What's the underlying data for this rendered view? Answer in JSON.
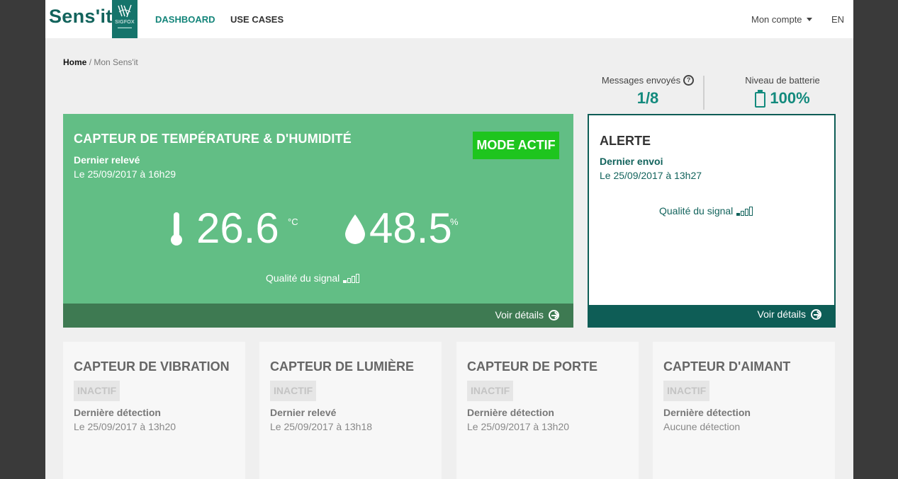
{
  "header": {
    "logo_text": "Sens'it",
    "logo_badge": "SIGFOX",
    "nav": [
      "DASHBOARD",
      "USE CASES"
    ],
    "account_label": "Mon compte",
    "language": "EN"
  },
  "breadcrumb": {
    "home": "Home",
    "separator": "/",
    "current": "Mon Sens'it"
  },
  "stats": {
    "messages_label": "Messages envoyés",
    "messages_value": "1/8",
    "battery_label": "Niveau de batterie",
    "battery_value": "100%",
    "battery_level": 1.0
  },
  "main_card": {
    "title": "CAPTEUR DE TEMPÉRATURE & D'HUMIDITÉ",
    "last_label": "Dernier relevé",
    "last_date": "Le 25/09/2017 à 16h29",
    "mode": "MODE ACTIF",
    "temperature": "26.6",
    "temperature_unit": "°C",
    "humidity": "48.5",
    "humidity_unit": "%",
    "signal_label": "Qualité du signal",
    "signal_level": 1,
    "details": "Voir détails",
    "color": "#62be85"
  },
  "alert_card": {
    "title": "ALERTE",
    "last_label": "Dernier envoi",
    "last_date": "Le 25/09/2017 à 13h27",
    "signal_label": "Qualité du signal",
    "signal_level": 1,
    "details": "Voir détails",
    "color": "#0e5d56"
  },
  "sensors": [
    {
      "title": "CAPTEUR DE VIBRATION",
      "status": "INACTIF",
      "last_label": "Dernière détection",
      "last_value": "Le 25/09/2017 à 13h20"
    },
    {
      "title": "CAPTEUR DE LUMIÈRE",
      "status": "INACTIF",
      "last_label": "Dernier relevé",
      "last_value": "Le 25/09/2017 à 13h18"
    },
    {
      "title": "CAPTEUR DE PORTE",
      "status": "INACTIF",
      "last_label": "Dernière détection",
      "last_value": "Le 25/09/2017 à 13h20"
    },
    {
      "title": "CAPTEUR D'AIMANT",
      "status": "INACTIF",
      "last_label": "Dernière détection",
      "last_value": "Aucune détection"
    }
  ]
}
